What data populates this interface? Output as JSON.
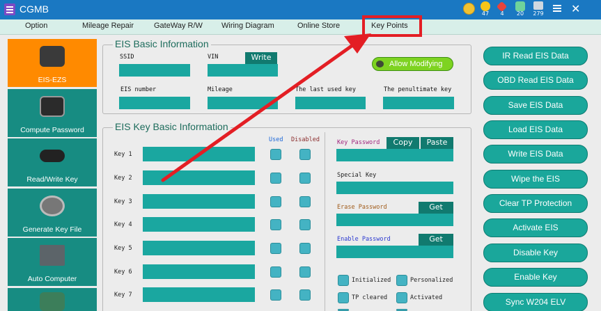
{
  "window": {
    "title": "CGMB",
    "counts": [
      "47",
      "4",
      "20",
      "279"
    ]
  },
  "menu": [
    "Option",
    "Mileage Repair",
    "GateWay R/W",
    "Wiring Diagram",
    "Online Store",
    "Key Points"
  ],
  "nav": [
    "EIS-EZS",
    "Compute Password",
    "Read/Write Key",
    "Generate Key File",
    "Auto Computer"
  ],
  "eis_basic": {
    "title": "EIS Basic Information",
    "ssid": "SSID",
    "vin": "VIN",
    "write": "Write",
    "allow_modifying": "Allow Modifying",
    "eis_number": "EIS number",
    "mileage": "Mileage",
    "last_used_key": "The last used key",
    "penultimate_key": "The penultimate key"
  },
  "eis_key": {
    "title": "EIS Key Basic Information",
    "used": "Used",
    "disabled": "Disabled",
    "keys": [
      "Key 1",
      "Key 2",
      "Key 3",
      "Key 4",
      "Key 5",
      "Key 6",
      "Key 7"
    ],
    "key_password": "Key Password",
    "copy": "Copy",
    "paste": "Paste",
    "special_key": "Special Key",
    "erase_password": "Erase Password",
    "get1": "Get",
    "enable_password": "Enable Password",
    "get2": "Get",
    "status": [
      "Initialized",
      "Personalized",
      "TP cleared",
      "Activated"
    ]
  },
  "actions": [
    "IR Read  EIS Data",
    "OBD Read  EIS Data",
    "Save EIS Data",
    "Load EIS Data",
    "Write EIS Data",
    "Wipe the EIS",
    "Clear TP Protection",
    "Activate EIS",
    "Disable Key",
    "Enable Key",
    "Sync W204 ELV"
  ],
  "colors": {
    "accent": "#1aa79b",
    "highlight": "#e31e24",
    "active_nav": "#ff8a00"
  }
}
